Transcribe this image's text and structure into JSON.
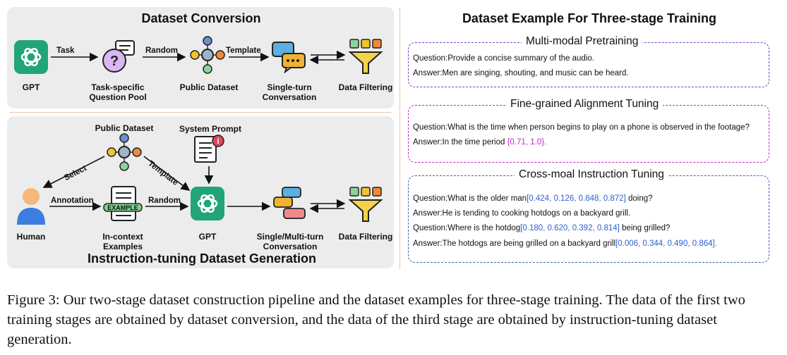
{
  "left_top": {
    "title": "Dataset Conversion",
    "nodes": {
      "gpt": "GPT",
      "pool_line1": "Task-specific",
      "pool_line2": "Question Pool",
      "public": "Public Dataset",
      "single_line1": "Single-turn",
      "single_line2": "Conversation",
      "filter": "Data Filtering"
    },
    "edges": {
      "task": "Task",
      "random": "Random",
      "template": "Template"
    }
  },
  "left_bottom": {
    "title": "Instruction-tuning Dataset Generation",
    "nodes": {
      "public": "Public Dataset",
      "system": "System Prompt",
      "human": "Human",
      "incontext_line1": "In-context",
      "incontext_line2": "Examples",
      "example_tag": "EXAMPLE",
      "gpt": "GPT",
      "multi_line1": "Single/Multi-turn",
      "multi_line2": "Conversation",
      "filter": "Data Filtering"
    },
    "edges": {
      "select": "Select",
      "template": "Template",
      "annotation": "Annotation",
      "random": "Random"
    }
  },
  "right": {
    "title": "Dataset Example For Three-stage Training",
    "stages": [
      {
        "title": "Multi-modal Pretraining",
        "color": "#7c3fc4",
        "lines": [
          {
            "text": "Question:Provide a concise summary of the audio.",
            "highlight": ""
          },
          {
            "text": "Answer:Men are singing, shouting, and music can be heard.",
            "highlight": ""
          }
        ]
      },
      {
        "title": "Fine-grained Alignment Tuning",
        "color": "#c024c9",
        "lines": [
          {
            "text": "Question:What is the time when person begins to play on a phone is observed in the footage?",
            "highlight": ""
          },
          {
            "text": "Answer:In the time period ",
            "highlight": "{0.71, 1.0}."
          }
        ]
      },
      {
        "title": "Cross-moal Instruction Tuning",
        "color": "#3f5fb8",
        "lines": [
          {
            "text": "Question:What is the older man",
            "highlight": "[0.424, 0.126, 0.848, 0.872]",
            "tail": " doing?"
          },
          {
            "text": "Answer:He is tending to cooking hotdogs on a backyard grill.",
            "highlight": ""
          },
          {
            "text": "Question:Where is the hotdog",
            "highlight": "[0.180, 0.620, 0.392, 0.814]",
            "tail": " being grilled?"
          },
          {
            "text": "Answer:The hotdogs are being grilled on a backyard grill",
            "highlight": "[0.006, 0.344, 0.490, 0.864]."
          }
        ]
      }
    ]
  },
  "caption": "Figure 3: Our two-stage dataset construction pipeline and the dataset examples for three-stage training. The data of the first two training stages are obtained by dataset conversion, and the data of the third stage are obtained by instruction-tuning dataset generation."
}
